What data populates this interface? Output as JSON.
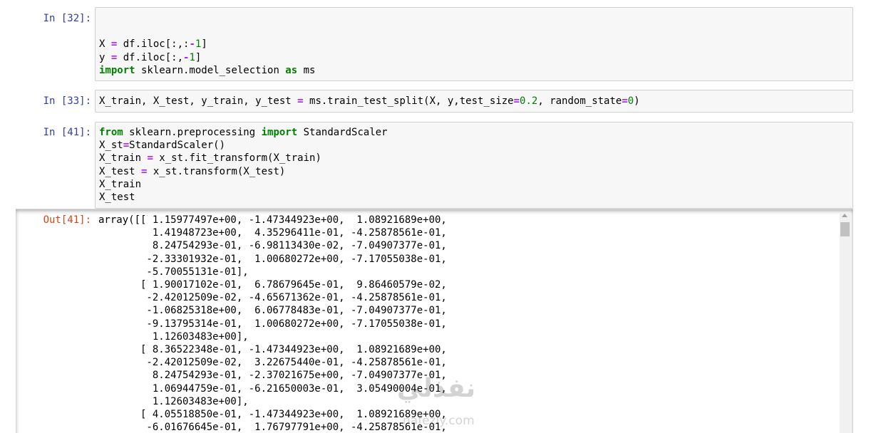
{
  "cells": [
    {
      "prompt": "In [32]:",
      "lines": [
        [
          {
            "t": ""
          }
        ],
        [
          {
            "t": ""
          }
        ],
        [
          {
            "t": "X "
          },
          {
            "t": "=",
            "c": "op"
          },
          {
            "t": " df.iloc[:,:"
          },
          {
            "t": "-",
            "c": "op"
          },
          {
            "t": "1",
            "c": "num"
          },
          {
            "t": "]"
          }
        ],
        [
          {
            "t": "y "
          },
          {
            "t": "=",
            "c": "op"
          },
          {
            "t": " df.iloc[:,"
          },
          {
            "t": "-",
            "c": "op"
          },
          {
            "t": "1",
            "c": "num"
          },
          {
            "t": "]"
          }
        ],
        [
          {
            "t": "import",
            "c": "kw"
          },
          {
            "t": " sklearn.model_selection "
          },
          {
            "t": "as",
            "c": "kw"
          },
          {
            "t": " ms"
          }
        ]
      ]
    },
    {
      "prompt": "In [33]:",
      "lines": [
        [
          {
            "t": "X_train, X_test, y_train, y_test "
          },
          {
            "t": "=",
            "c": "op"
          },
          {
            "t": " ms.train_test_split(X, y,test_size"
          },
          {
            "t": "=",
            "c": "op"
          },
          {
            "t": "0.2",
            "c": "num"
          },
          {
            "t": ", random_state"
          },
          {
            "t": "=",
            "c": "op"
          },
          {
            "t": "0",
            "c": "num"
          },
          {
            "t": ")"
          }
        ]
      ]
    },
    {
      "prompt": "In [41]:",
      "lines": [
        [
          {
            "t": "from",
            "c": "kw"
          },
          {
            "t": " sklearn.preprocessing "
          },
          {
            "t": "import",
            "c": "kw"
          },
          {
            "t": " StandardScaler"
          }
        ],
        [
          {
            "t": "X_st"
          },
          {
            "t": "=",
            "c": "op"
          },
          {
            "t": "StandardScaler()"
          }
        ],
        [
          {
            "t": "X_train "
          },
          {
            "t": "=",
            "c": "op"
          },
          {
            "t": " x_st.fit_transform(X_train)"
          }
        ],
        [
          {
            "t": "X_test "
          },
          {
            "t": "=",
            "c": "op"
          },
          {
            "t": " x_st.transform(X_test)"
          }
        ],
        [
          {
            "t": "X_train"
          }
        ],
        [
          {
            "t": "X_test"
          }
        ]
      ]
    }
  ],
  "output": {
    "prompt": "Out[41]:",
    "lines": [
      "array([[ 1.15977497e+00, -1.47344923e+00,  1.08921689e+00,",
      "         1.41948723e+00,  4.35296411e-01, -4.25878561e-01,",
      "         8.24754293e-01, -6.98113430e-02, -7.04907377e-01,",
      "        -2.33301932e-01,  1.00680272e+00, -7.17055038e-01,",
      "        -5.70055131e-01],",
      "       [ 1.90017102e-01,  6.78679645e-01,  9.86460579e-02,",
      "        -2.42012509e-02, -4.65671362e-01, -4.25878561e-01,",
      "        -1.06825318e+00,  6.06778483e-01, -7.04907377e-01,",
      "        -9.13795314e-01,  1.00680272e+00, -7.17055038e-01,",
      "         1.12603483e+00],",
      "       [ 8.36522348e-01, -1.47344923e+00,  1.08921689e+00,",
      "        -2.42012509e-02,  3.22675440e-01, -4.25878561e-01,",
      "         8.24754293e-01, -2.37021675e+00, -7.04907377e-01,",
      "         1.06944759e-01, -6.21650003e-01,  3.05490004e-01,",
      "         1.12603483e+00],",
      "       [ 4.05518850e-01, -1.47344923e+00,  1.08921689e+00,",
      "        -6.01676645e-01,  1.76797791e+00, -4.25878561e-01,"
    ]
  },
  "watermark": {
    "arabic": "نفذلي",
    "latin": "nafezly.com"
  }
}
